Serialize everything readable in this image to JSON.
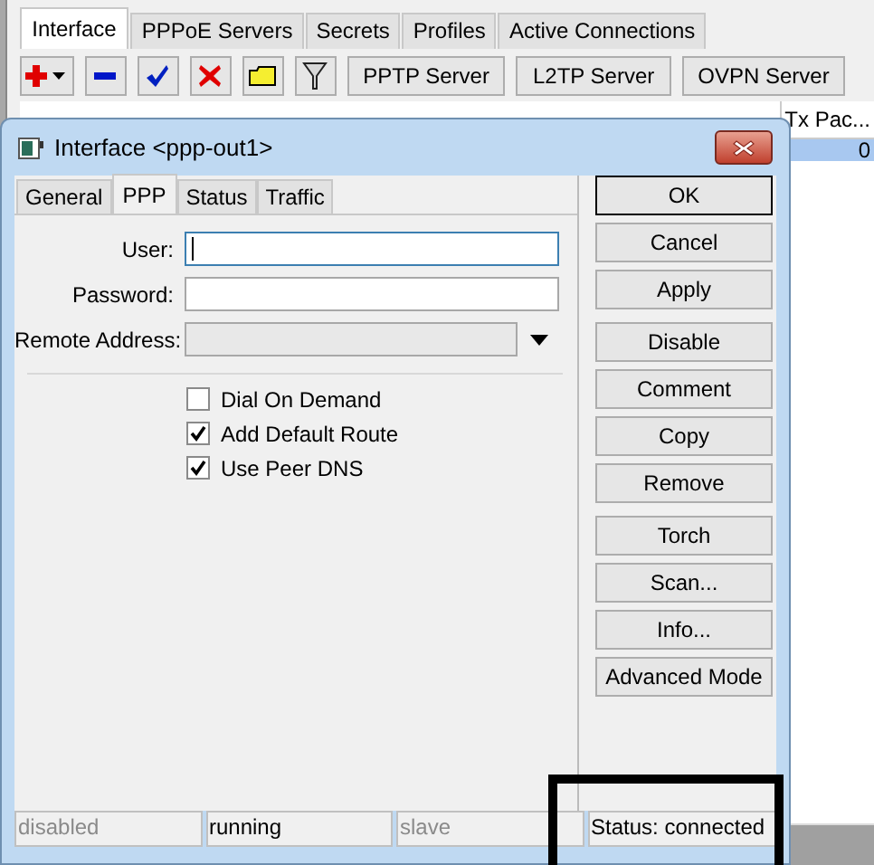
{
  "main_tabs": [
    {
      "label": "Interface",
      "selected": true
    },
    {
      "label": "PPPoE Servers",
      "selected": false
    },
    {
      "label": "Secrets",
      "selected": false
    },
    {
      "label": "Profiles",
      "selected": false
    },
    {
      "label": "Active Connections",
      "selected": false
    }
  ],
  "toolbar": {
    "icons": [
      {
        "kind": "add"
      },
      {
        "kind": "remove"
      },
      {
        "kind": "enable"
      },
      {
        "kind": "disable"
      },
      {
        "kind": "comment"
      },
      {
        "kind": "filter"
      }
    ],
    "buttons": [
      "PPTP Server",
      "L2TP Server",
      "OVPN Server"
    ]
  },
  "table": {
    "columns": [
      "Tx Pac..."
    ],
    "rows": [
      {
        "cells": [
          "0"
        ],
        "selected": true
      }
    ]
  },
  "dialog": {
    "title": "Interface <ppp-out1>",
    "tabs": [
      {
        "label": "General",
        "selected": false
      },
      {
        "label": "PPP",
        "selected": true
      },
      {
        "label": "Status",
        "selected": false
      },
      {
        "label": "Traffic",
        "selected": false
      }
    ],
    "fields": [
      {
        "label": "User:",
        "kind": "text",
        "focused": true
      },
      {
        "label": "Password:",
        "kind": "text",
        "focused": false
      },
      {
        "label": "Remote Address:",
        "kind": "dropdown"
      }
    ],
    "checkboxes": [
      {
        "label": "Dial On Demand",
        "checked": false
      },
      {
        "label": "Add Default Route",
        "checked": true
      },
      {
        "label": "Use Peer DNS",
        "checked": true
      }
    ],
    "button_groups": [
      [
        {
          "label": "OK",
          "default": true
        },
        {
          "label": "Cancel",
          "default": false
        },
        {
          "label": "Apply",
          "default": false
        }
      ],
      [
        {
          "label": "Disable",
          "default": false
        },
        {
          "label": "Comment",
          "default": false
        },
        {
          "label": "Copy",
          "default": false
        },
        {
          "label": "Remove",
          "default": false
        }
      ],
      [
        {
          "label": "Torch",
          "default": false
        },
        {
          "label": "Scan...",
          "default": false
        },
        {
          "label": "Info...",
          "default": false
        },
        {
          "label": "Advanced Mode",
          "default": false
        }
      ]
    ],
    "status_bar": [
      {
        "text": "disabled",
        "dimmed": true
      },
      {
        "text": "running",
        "dimmed": false
      },
      {
        "text": "slave",
        "dimmed": true
      },
      {
        "text": "Status: connected",
        "dimmed": false,
        "highlighted": true
      }
    ]
  }
}
